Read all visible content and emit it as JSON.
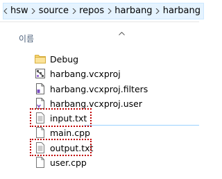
{
  "breadcrumb": [
    "hsw",
    "source",
    "repos",
    "harbang",
    "harbang"
  ],
  "column_header": {
    "name_label": "이름"
  },
  "files": [
    {
      "name": "Debug",
      "icon": "folder-icon"
    },
    {
      "name": "harbang.vcxproj",
      "icon": "vcxproj-icon"
    },
    {
      "name": "harbang.vcxproj.filters",
      "icon": "filters-file-icon"
    },
    {
      "name": "harbang.vcxproj.user",
      "icon": "vs-user-file-icon"
    },
    {
      "name": "input.txt",
      "icon": "text-file-icon"
    },
    {
      "name": "main.cpp",
      "icon": "document-icon"
    },
    {
      "name": "output.txt",
      "icon": "text-file-icon"
    },
    {
      "name": "user.cpp",
      "icon": "document-icon"
    }
  ],
  "colors": {
    "breadcrumb_bg": "#e5f3ff",
    "highlight": "#c00000",
    "folder": "#f8d775"
  }
}
